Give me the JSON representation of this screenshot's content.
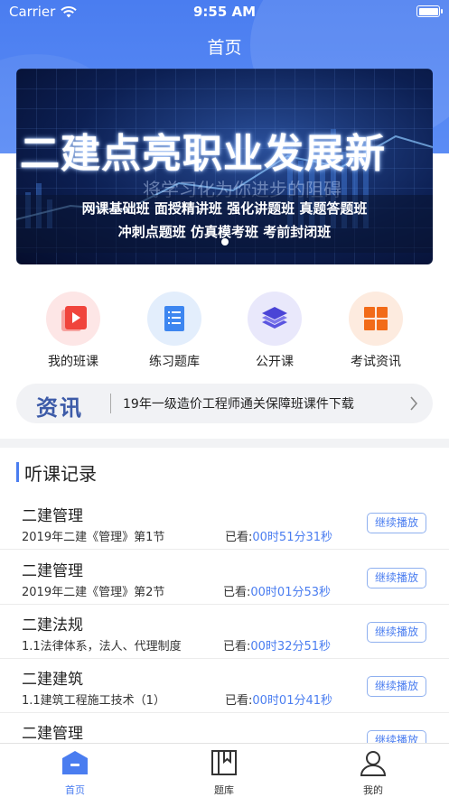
{
  "status_bar": {
    "carrier": "Carrier",
    "time": "9:55 AM"
  },
  "nav": {
    "title": "首页"
  },
  "banner": {
    "headline": "二建点亮职业发展新",
    "subline": "将学习化为你进步的阻碍",
    "row1": "网课基础班   面授精讲班   强化讲题班   真题答题班",
    "row2": "冲刺点题班   仿真模考班   考前封闭班",
    "page_count": 3,
    "active_page": 1
  },
  "quick_menu": [
    {
      "label": "我的班课",
      "icon": "video-play-icon",
      "color": "#f0443c",
      "bg": "#fde6e6"
    },
    {
      "label": "练习题库",
      "icon": "document-list-icon",
      "color": "#3d86f0",
      "bg": "#e3eefc"
    },
    {
      "label": "公开课",
      "icon": "layers-icon",
      "color": "#5b55e0",
      "bg": "#e9e8fb"
    },
    {
      "label": "考试资讯",
      "icon": "grid-icon",
      "color": "#f26b18",
      "bg": "#fdebdf"
    }
  ],
  "news": {
    "tag": "资讯",
    "text": "19年一级造价工程师通关保障班课件下载"
  },
  "records_section": {
    "title": "听课记录"
  },
  "records": [
    {
      "subject": "二建管理",
      "lesson": "2019年二建《管理》第1节",
      "watched_label": "已看:",
      "duration": "00时51分31秒",
      "action": "继续播放"
    },
    {
      "subject": "二建管理",
      "lesson": "2019年二建《管理》第2节",
      "watched_label": "已看:",
      "duration": "00时01分53秒",
      "action": "继续播放"
    },
    {
      "subject": "二建法规",
      "lesson": "1.1法律体系，法人、代理制度",
      "watched_label": "已看:",
      "duration": "00时32分51秒",
      "action": "继续播放"
    },
    {
      "subject": "二建建筑",
      "lesson": "1.1建筑工程施工技术（1）",
      "watched_label": "已看:",
      "duration": "00时01分41秒",
      "action": "继续播放"
    },
    {
      "subject": "二建管理",
      "lesson": "",
      "watched_label": "",
      "duration": "",
      "action": "继续播放"
    }
  ],
  "tabbar": [
    {
      "label": "首页",
      "icon": "home-icon",
      "active": true
    },
    {
      "label": "题库",
      "icon": "book-icon",
      "active": false
    },
    {
      "label": "我的",
      "icon": "user-icon",
      "active": false
    }
  ],
  "colors": {
    "primary": "#4a7df0",
    "text": "#222222",
    "inactive": "#333333"
  }
}
